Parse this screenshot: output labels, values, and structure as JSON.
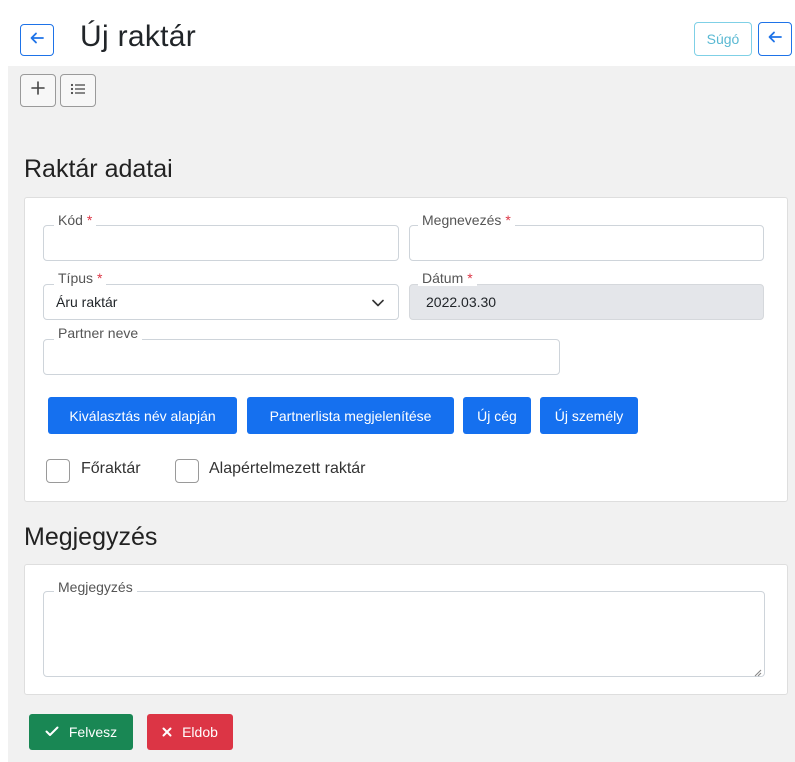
{
  "header": {
    "title": "Új raktár",
    "help_label": "Súgó"
  },
  "sections": {
    "warehouse_title": "Raktár adatai",
    "note_title": "Megjegyzés"
  },
  "form": {
    "code": {
      "label": "Kód",
      "value": "",
      "required": "*"
    },
    "name": {
      "label": "Megnevezés",
      "value": "",
      "required": "*"
    },
    "type": {
      "label": "Típus",
      "value": "Áru raktár",
      "required": "*"
    },
    "date": {
      "label": "Dátum",
      "value": "2022.03.30",
      "required": "*"
    },
    "partner": {
      "label": "Partner neve",
      "value": ""
    }
  },
  "partner_buttons": {
    "select_by_name": "Kiválasztás név alapján",
    "show_list": "Partnerlista megjelenítése",
    "new_company": "Új cég",
    "new_person": "Új személy"
  },
  "checkboxes": {
    "main_warehouse": "Főraktár",
    "default_warehouse": "Alapértelmezett raktár"
  },
  "note": {
    "label": "Megjegyzés",
    "value": ""
  },
  "actions": {
    "save": "Felvesz",
    "discard": "Eldob"
  },
  "colors": {
    "primary": "#1570ef",
    "success": "#198754",
    "danger": "#dc3545",
    "info": "#5ab9d3"
  }
}
